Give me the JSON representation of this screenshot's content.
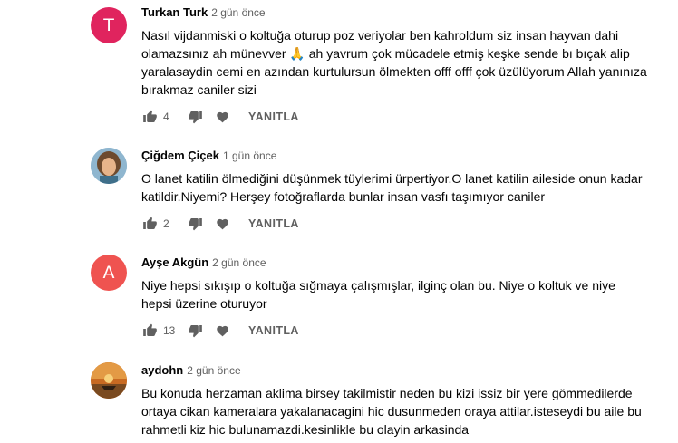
{
  "reply_label": "YANITLA",
  "comments": [
    {
      "author": "Turkan Turk",
      "time": "2 gün önce",
      "avatar_letter": "T",
      "avatar_color": "#e0245e",
      "text": "Nasıl vijdanmiski o koltuğa oturup poz veriyolar ben kahroldum siz insan hayvan dahi olamazsınız ah münevver 🙏 ah yavrum çok mücadele etmiş keşke sende bı bıçak alip yaralasaydin cemi en azından kurtulursun ölmekten offf offf çok üzülüyorum Allah yanınıza bırakmaz caniler sizi",
      "likes": "4"
    },
    {
      "author": "Çiğdem Çiçek",
      "time": "1 gün önce",
      "avatar_letter": "",
      "avatar_color": "#8fb6cf",
      "text": "O lanet katilin ölmediğini düşünmek tüylerimi ürpertiyor.O lanet katilin aileside onun kadar katildir.Niyemi? Herşey fotoğraflarda bunlar insan vasfı taşımıyor caniler",
      "likes": "2"
    },
    {
      "author": "Ayşe Akgün",
      "time": "2 gün önce",
      "avatar_letter": "A",
      "avatar_color": "#ef5350",
      "text": "Niye hepsi sıkışıp o koltuğa sığmaya çalışmışlar,  ilginç olan bu. Niye o koltuk ve niye hepsi üzerine oturuyor",
      "likes": "13"
    },
    {
      "author": "aydohn",
      "time": "2 gün önce",
      "avatar_letter": "",
      "avatar_color": "#d97a2b",
      "text": "Bu konuda herzaman aklima birsey takilmistir neden bu kizi issiz bir yere gömmedilerde ortaya cikan kameralara yakalanacagini hic dusunmeden oraya attilar.isteseydi bu aile bu rahmetli kiz hic bulunamazdi.kesinlikle bu olayin arkasinda",
      "likes": ""
    }
  ]
}
